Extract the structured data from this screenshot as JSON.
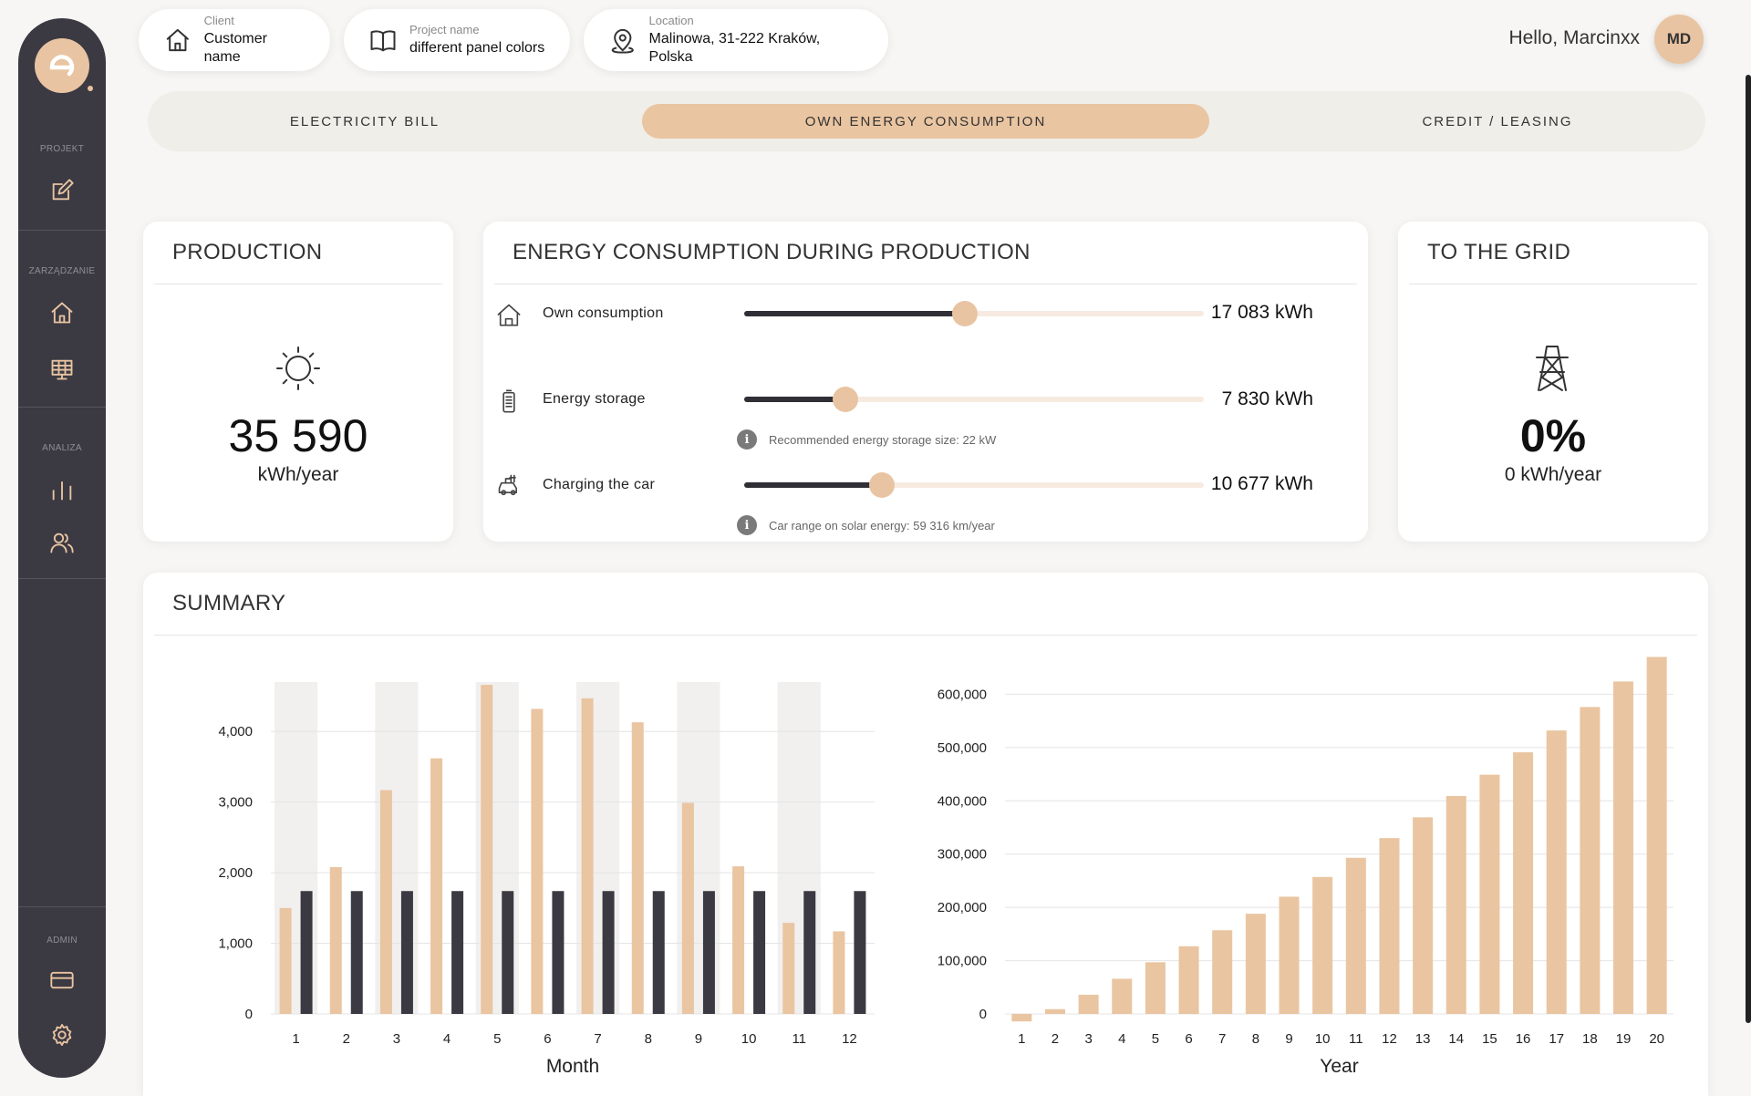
{
  "sidebar": {
    "sections": [
      "PROJEKT",
      "ZARZĄDZANIE",
      "ANALIZA",
      "ADMIN"
    ],
    "icons": [
      "edit-icon",
      "home-icon",
      "solar-panel-icon",
      "bar-chart-icon",
      "users-icon",
      "card-icon",
      "gear-icon"
    ]
  },
  "header": {
    "client_label": "Client",
    "client_value": "Customer name",
    "project_label": "Project name",
    "project_value": "different panel colors",
    "location_label": "Location",
    "location_value": "Malinowa, 31-222 Kraków, Polska",
    "greeting": "Hello, Marcinxx",
    "avatar_initials": "MD"
  },
  "tabs": [
    {
      "label": "ELECTRICITY BILL",
      "active": false
    },
    {
      "label": "OWN ENERGY CONSUMPTION",
      "active": true
    },
    {
      "label": "CREDIT / LEASING",
      "active": false
    }
  ],
  "production": {
    "title": "PRODUCTION",
    "value": "35 590",
    "unit": "kWh/year"
  },
  "consumption": {
    "title": "ENERGY CONSUMPTION DURING PRODUCTION",
    "rows": [
      {
        "label": "Own consumption",
        "value": "17 083 kWh",
        "level": 0.48
      },
      {
        "label": "Energy storage",
        "value": "7 830 kWh",
        "level": 0.22,
        "note": "Recommended energy storage size: 22 kW"
      },
      {
        "label": "Charging the car",
        "value": "10 677 kWh",
        "level": 0.3,
        "note": "Car range on solar energy: 59 316 km/year"
      }
    ]
  },
  "grid": {
    "title": "TO THE GRID",
    "percent": "0%",
    "value": "0 kWh/year"
  },
  "summary": {
    "title": "SUMMARY"
  },
  "chart_data": [
    {
      "type": "bar",
      "xlabel": "Month",
      "ylabel": "",
      "categories": [
        "1",
        "2",
        "3",
        "4",
        "5",
        "6",
        "7",
        "8",
        "9",
        "10",
        "11",
        "12"
      ],
      "ylim": [
        0,
        4700
      ],
      "yticks": [
        "0",
        "1,000",
        "2,000",
        "3,000",
        "4,000"
      ],
      "ytick_values": [
        0,
        1000,
        2000,
        3000,
        4000
      ],
      "series": [
        {
          "values": [
            1500,
            2080,
            3170,
            3620,
            4660,
            4320,
            4470,
            4130,
            2990,
            2090,
            1290,
            1170
          ],
          "color": "#eac5a1"
        },
        {
          "values": [
            1740,
            1740,
            1740,
            1740,
            1740,
            1740,
            1740,
            1740,
            1740,
            1740,
            1740,
            1740
          ],
          "color": "#3b3a42"
        }
      ],
      "shaded_categories": [
        "1",
        "3",
        "5",
        "7",
        "9",
        "11"
      ]
    },
    {
      "type": "bar",
      "xlabel": "Year",
      "ylabel": "",
      "categories": [
        "1",
        "2",
        "3",
        "4",
        "5",
        "6",
        "7",
        "8",
        "9",
        "10",
        "11",
        "12",
        "13",
        "14",
        "15",
        "16",
        "17",
        "18",
        "19",
        "20"
      ],
      "ylim": [
        0,
        640000
      ],
      "yticks": [
        "0",
        "100,000",
        "200,000",
        "300,000",
        "400,000",
        "500,000",
        "600,000"
      ],
      "ytick_values": [
        0,
        100000,
        200000,
        300000,
        400000,
        500000,
        600000
      ],
      "series": [
        {
          "values": [
            -14000,
            9000,
            36000,
            66000,
            97000,
            127000,
            157000,
            188000,
            220000,
            257000,
            293000,
            330000,
            369000,
            409000,
            449000,
            491000,
            532000,
            576000,
            624000,
            670000
          ],
          "color": "#eac5a1"
        }
      ]
    }
  ]
}
